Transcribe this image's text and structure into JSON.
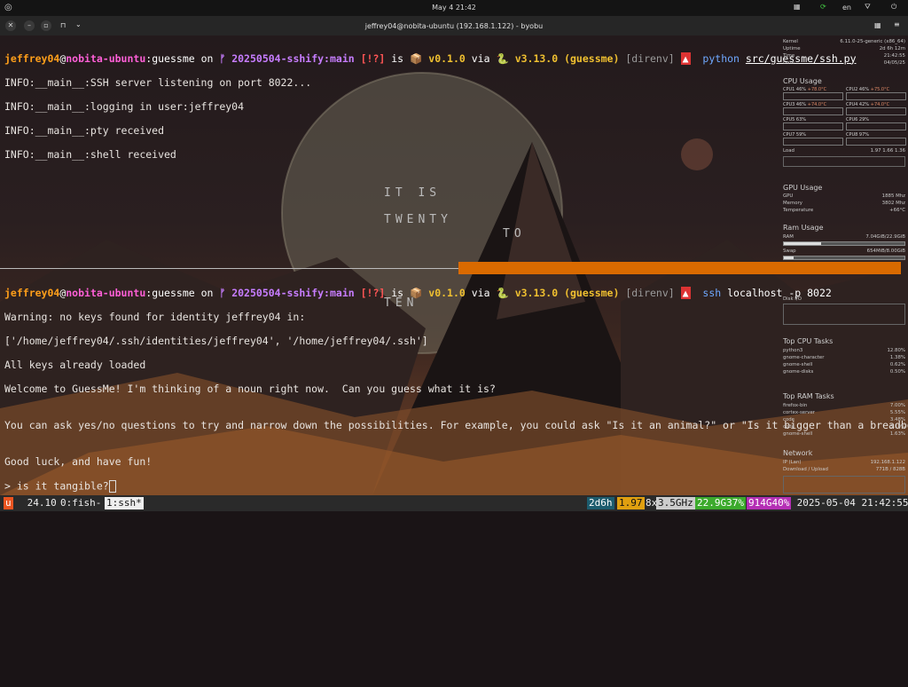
{
  "topbar": {
    "clock": "May 4  21:42",
    "lang": "en"
  },
  "window": {
    "title": "jeffrey04@nobita-ubuntu (192.168.1.122) - byobu"
  },
  "pane1": {
    "prompt": {
      "user": "jeffrey04",
      "at": "@",
      "host": "nobita-ubuntu",
      "sep": ":",
      "dir": "guessme",
      "on": " on ",
      "branch_icon": "ᚠ",
      "branch": " 20250504-sshify:main",
      "git_status": " [!?]",
      "is": " is ",
      "pkg_icon": "📦",
      "version": " v0.1.0",
      "via": " via ",
      "py_icon": "🐍",
      "pyver": " v3.13.0 (guessme)",
      "direnv": " [direnv] ",
      "warn": "▲",
      "cmd": "  python ",
      "arg": "src/guessme/ssh.py"
    },
    "lines": [
      "INFO:__main__:SSH server listening on port 8022...",
      "INFO:__main__:logging in user:jeffrey04",
      "INFO:__main__:pty received",
      "INFO:__main__:shell received"
    ]
  },
  "pane2": {
    "prompt": {
      "user": "jeffrey04",
      "at": "@",
      "host": "nobita-ubuntu",
      "sep": ":",
      "dir": "guessme",
      "on": " on ",
      "branch_icon": "ᚠ",
      "branch": " 20250504-sshify:main",
      "git_status": " [!?]",
      "is": " is ",
      "pkg_icon": "📦",
      "version": " v0.1.0",
      "via": " via ",
      "py_icon": "🐍",
      "pyver": " v3.13.0 (guessme)",
      "direnv": " [direnv] ",
      "warn": "▲",
      "cmd": "  ssh",
      "arg": " localhost -p 8022"
    },
    "lines": [
      "Warning: no keys found for identity jeffrey04 in:",
      "['/home/jeffrey04/.ssh/identities/jeffrey04', '/home/jeffrey04/.ssh']",
      "All keys already loaded",
      "Welcome to GuessMe! I'm thinking of a noun right now.  Can you guess what it is?",
      "",
      "You can ask yes/no questions to try and narrow down the possibilities. For example, you could ask \"Is it an animal?\" or \"Is it bigger than a breadbox?\".",
      "",
      "Good luck, and have fun!"
    ],
    "input_prompt": "> ",
    "input_value": "is it tangible?"
  },
  "wordclock": {
    "rows": [
      "IT IS",
      "TWENTY",
      "TO",
      "TEN"
    ]
  },
  "conky": {
    "sections": {
      "cpu": "CPU Usage",
      "gpu": "GPU Usage",
      "ram": "Ram Usage",
      "tasks": "Top CPU Tasks",
      "ram_tasks": "Top RAM Tasks",
      "net": "Network"
    },
    "sys": [
      {
        "label": "Kernel",
        "value": "6.11.0-25-generic (x86_64)"
      },
      {
        "label": "Uptime",
        "value": "2d 6h 12m"
      },
      {
        "label": "Time",
        "value": "21:42:55"
      },
      {
        "label": "Date",
        "value": "04/05/25"
      }
    ],
    "cpus": [
      {
        "label": "CPU1 46%",
        "temp": "+78.0°C"
      },
      {
        "label": "CPU2 46%",
        "temp": "+75.0°C"
      },
      {
        "label": "CPU3 46%",
        "temp": "+74.0°C"
      },
      {
        "label": "CPU4 42%",
        "temp": "+74.0°C"
      },
      {
        "label": "CPU5 63%",
        "temp": ""
      },
      {
        "label": "CPU6 29%",
        "temp": ""
      },
      {
        "label": "CPU7 59%",
        "temp": ""
      },
      {
        "label": "CPU8 97%",
        "temp": ""
      }
    ],
    "load": {
      "label": "Load",
      "value": "1.97 1.66 1.36"
    },
    "gpu": [
      {
        "label": "GPU",
        "value": "1885 Mhz"
      },
      {
        "label": "Memory",
        "value": "3802 Mhz"
      },
      {
        "label": "Temperature",
        "value": "+66°C"
      }
    ],
    "ram": {
      "label": "RAM",
      "value": "7.04GiB/22.9GiB",
      "fraction": 0.31
    },
    "swap": {
      "label": "Swap",
      "value": "654MiB/8.00GiB",
      "fraction": 0.08
    },
    "disk": {
      "label": "Disk I/O"
    },
    "top_cpu": [
      {
        "name": "python3",
        "value": "12.80%"
      },
      {
        "name": "gnome-character",
        "value": "1.38%"
      },
      {
        "name": "gnome-shell",
        "value": "0.62%"
      },
      {
        "name": "gnome-disks",
        "value": "0.50%"
      }
    ],
    "top_ram": [
      {
        "name": "firefox-bin",
        "value": "7.00%"
      },
      {
        "name": "cortex-server",
        "value": "5.55%"
      },
      {
        "name": "code",
        "value": "3.48%"
      },
      {
        "name": "code",
        "value": "3.10%"
      },
      {
        "name": "gnome-shell",
        "value": "1.63%"
      }
    ],
    "net": [
      {
        "label": "IP (Lan)",
        "value": "192.168.1.122"
      },
      {
        "label": "Download / Upload",
        "value": "771B / 828B"
      }
    ]
  },
  "statusbar": {
    "logo": "u",
    "release": " 24.10 ",
    "win0": "0:fish- ",
    "win1": "1:ssh*",
    "uptime": "2d6h",
    "load": "1.97",
    "cpu_count": "8x",
    "freq": "3.5GHz",
    "mem": "22.9G37%",
    "disk": "914G40%",
    "datetime": " 2025-05-04 21:42:55"
  }
}
